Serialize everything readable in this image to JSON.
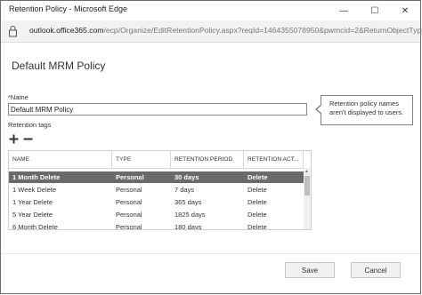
{
  "window": {
    "title": "Retention Policy - Microsoft Edge",
    "minimize_glyph": "—",
    "maximize_glyph": "☐",
    "close_glyph": "✕"
  },
  "address_bar": {
    "domain": "outlook.office365.com",
    "path": "/ecp/Organize/EditRetentionPolicy.aspx?reqId=1464355078950&pwmcid=2&ReturnObjectType="
  },
  "page": {
    "heading": "Default MRM Policy",
    "name_label": "*Name",
    "name_value": "Default MRM Policy",
    "tooltip": "Retention policy names aren't displayed to users.",
    "tags_label": "Retention tags"
  },
  "toolbar": {
    "add_icon": "plus-icon",
    "remove_icon": "minus-icon"
  },
  "table": {
    "columns": [
      "NAME",
      "TYPE",
      "RETENTION PERIOD",
      "RETENTION ACT..."
    ],
    "rows": [
      {
        "name": "1 Month Delete",
        "type": "Personal",
        "period": "30 days",
        "action": "Delete",
        "selected": true
      },
      {
        "name": "1 Week Delete",
        "type": "Personal",
        "period": "7 days",
        "action": "Delete",
        "selected": false
      },
      {
        "name": "1 Year Delete",
        "type": "Personal",
        "period": "365 days",
        "action": "Delete",
        "selected": false
      },
      {
        "name": "5 Year Delete",
        "type": "Personal",
        "period": "1825 days",
        "action": "Delete",
        "selected": false
      },
      {
        "name": "6 Month Delete",
        "type": "Personal",
        "period": "180 days",
        "action": "Delete",
        "selected": false
      }
    ]
  },
  "footer": {
    "save_label": "Save",
    "cancel_label": "Cancel"
  }
}
